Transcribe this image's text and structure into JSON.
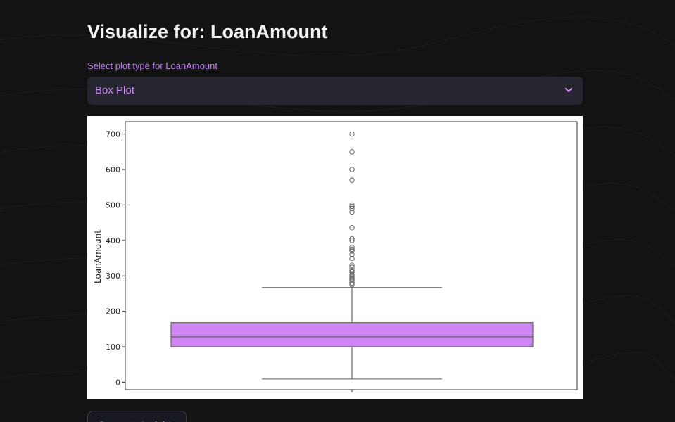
{
  "page": {
    "title": "Visualize for: LoanAmount"
  },
  "select": {
    "label": "Select plot type for LoanAmount",
    "value": "Box Plot"
  },
  "button": {
    "label": "Generate Insights"
  },
  "colors": {
    "accent": "#d38bff",
    "box_fill": "#cf85f3",
    "background": "#131313"
  },
  "chart_data": {
    "type": "box",
    "ylabel": "LoanAmount",
    "xlabel": "",
    "title": "",
    "ylim": [
      -21,
      735
    ],
    "yticks": [
      0,
      100,
      200,
      300,
      400,
      500,
      600,
      700
    ],
    "grid": false,
    "box": {
      "whisker_low": 9,
      "q1": 100,
      "median": 128,
      "q3": 168,
      "whisker_high": 267
    },
    "outliers": [
      700,
      650,
      600,
      570,
      500,
      496,
      490,
      480,
      436,
      405,
      400,
      380,
      375,
      370,
      360,
      349,
      330,
      324,
      315,
      311,
      304,
      300,
      296,
      292,
      290,
      286,
      280,
      275
    ]
  }
}
